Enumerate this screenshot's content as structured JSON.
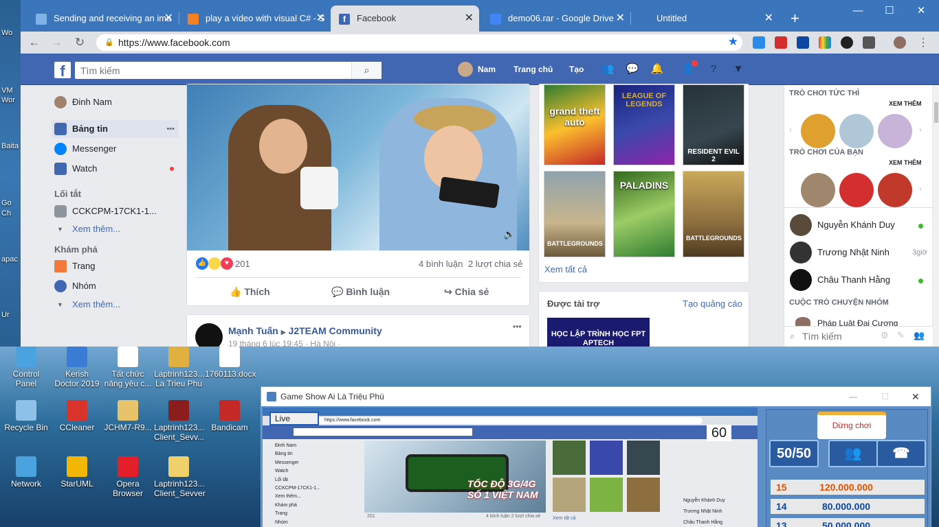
{
  "desktop": {
    "left_labels": [
      "Wo",
      "VM",
      "Wor",
      "Baita",
      "Go",
      "Ch",
      "apac",
      "Ur"
    ],
    "icons": [
      {
        "label": "Control Panel",
        "color": "#4aa3df"
      },
      {
        "label": "Kerish Doctor 2019",
        "color": "#3a7bd5"
      },
      {
        "label": "Tất chức năng yêu c...",
        "color": "#ffffff"
      },
      {
        "label": "Laptrinh123... La Trieu Phu",
        "color": "#e0b040"
      },
      {
        "label": "1760113.docx",
        "color": "#ffffff"
      },
      {
        "label": "Recycle Bin",
        "color": "#8fc1e8"
      },
      {
        "label": "CCleaner",
        "color": "#d9342b"
      },
      {
        "label": "JCHM7-R9...",
        "color": "#e8c36a"
      },
      {
        "label": "Laptrinh123... Client_Sevv...",
        "color": "#8b1d1d"
      },
      {
        "label": "Bandicam",
        "color": "#c62828"
      },
      {
        "label": "Network",
        "color": "#4aa3df"
      },
      {
        "label": "StarUML",
        "color": "#f2b705"
      },
      {
        "label": "Opera Browser",
        "color": "#e3202a"
      },
      {
        "label": "Laptrinh123... Client_Sevver",
        "color": "#f0d06a"
      }
    ]
  },
  "browser": {
    "tabs": [
      {
        "title": "Sending and receiving an ima",
        "fav": "#7fb3e8"
      },
      {
        "title": "play a video with visual C# - S",
        "fav": "#f48024"
      },
      {
        "title": "Facebook",
        "fav": "#4267b2"
      },
      {
        "title": "demo06.rar - Google Drive",
        "fav": "#4285f4"
      },
      {
        "title": "Untitled",
        "fav": ""
      }
    ],
    "new_tab": "+",
    "url": "https://www.facebook.com",
    "controls": {
      "min": "—",
      "max": "☐",
      "close": "✕"
    }
  },
  "facebook": {
    "logo": "f",
    "search_placeholder": "Tìm kiếm",
    "user": "Nam",
    "nav_home": "Trang chủ",
    "nav_create": "Tạo",
    "left": {
      "profile": "Đinh Nam",
      "news_feed": "Bảng tin",
      "more_dots": "•••",
      "messenger": "Messenger",
      "watch": "Watch",
      "shortcuts_heading": "Lối tắt",
      "group": "CCKCPM-17CK1-1...",
      "see_more": "Xem thêm...",
      "explore_heading": "Khám phá",
      "pages": "Trang",
      "groups": "Nhóm",
      "see_more2": "Xem thêm..."
    },
    "post": {
      "reactions_count": "201",
      "comments": "4 bình luận",
      "shares": "2 lượt chia sẻ",
      "like": "Thích",
      "comment": "Bình luận",
      "share": "Chia sẻ"
    },
    "post2": {
      "author": "Mạnh Tuấn",
      "arrow": "▶",
      "group": "J2TEAM Community",
      "time": "19 tháng 6 lúc 19:45 · Hà Nội ·",
      "dots": "•••"
    },
    "games": {
      "tiles": [
        "grand theft auto",
        "LEAGUE OF LEGENDS",
        "RESIDENT EVIL 2",
        "BATTLEGROUNDS",
        "PALADINS",
        "BATTLEGROUNDS"
      ],
      "see_all": "Xem tất cả"
    },
    "sponsored": {
      "heading": "Được tài trợ",
      "create_ad": "Tạo quảng cáo",
      "ad_text": "HỌC LẬP TRÌNH HỌC FPT APTECH"
    },
    "chat": {
      "instant_games": "TRÒ CHƠI TỨC THÌ",
      "see_more": "XEM THÊM",
      "your_games": "TRÒ CHƠI CỦA BẠN",
      "see_more2": "XEM THÊM",
      "contacts": [
        {
          "name": "Nguyễn Khánh Duy",
          "status": "online"
        },
        {
          "name": "Trương Nhật Ninh",
          "status": "3giờ"
        },
        {
          "name": "Châu Thanh Hằng",
          "status": "online"
        }
      ],
      "group_heading": "CUỘC TRÒ CHUYỆN NHÓM",
      "group_item": "Pháp Luật Đại Cương",
      "search_placeholder": "Tìm kiếm"
    }
  },
  "gameshow": {
    "title": "Game Show Ai Là Triệu Phú",
    "live_button": "Live",
    "timer": "60",
    "start_button": "Dừng chơi",
    "lifeline_5050": "50/50",
    "prizes": [
      {
        "level": "15",
        "amount": "120.000.000"
      },
      {
        "level": "14",
        "amount": "80.000.000"
      },
      {
        "level": "13",
        "amount": "50.000.000"
      }
    ],
    "mini": {
      "url": "https://www.facebook.com",
      "video_text": "TỐC ĐỘ 3G/4G SỐ 1 VIỆT NAM",
      "left_items": [
        "Đinh Nam",
        "Bảng tin",
        "Messenger",
        "Watch",
        "Lối tắt",
        "CCKCPM-17CK1-1...",
        "Xem thêm...",
        "Khám phá",
        "Trang",
        "Nhóm"
      ],
      "see_all": "Xem tất cả",
      "count": "201",
      "stats": "4 bình luận  2 lượt chia sẻ",
      "contacts": [
        "Nguyễn Khánh Duy",
        "Trương Nhật Ninh",
        "Châu Thanh Hằng"
      ]
    }
  }
}
